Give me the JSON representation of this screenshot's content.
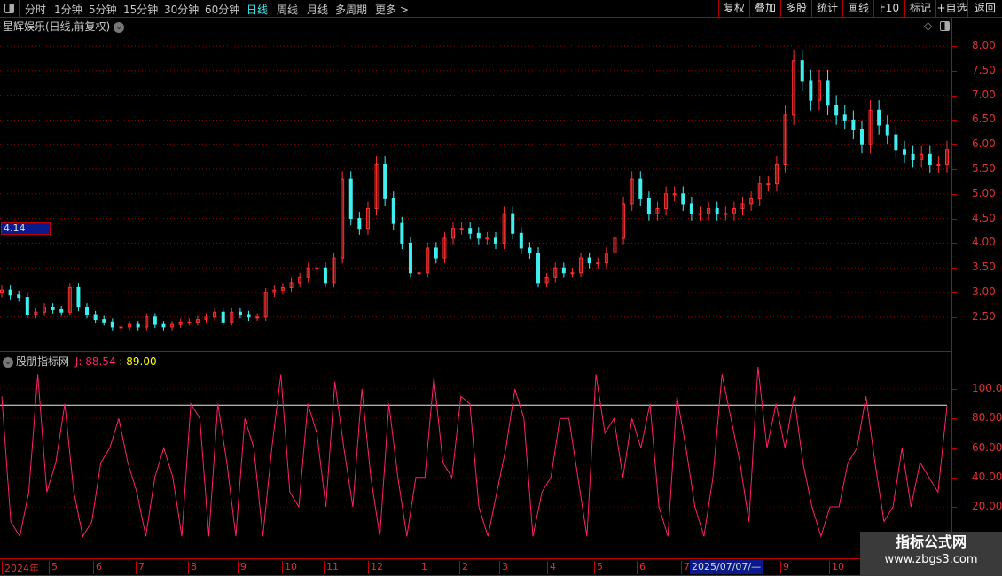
{
  "toolbar": {
    "periods": [
      "分时",
      "1分钟",
      "5分钟",
      "15分钟",
      "30分钟",
      "60分钟",
      "日线",
      "周线",
      "月线",
      "多周期",
      "更多 >"
    ],
    "active": "日线",
    "right_buttons": [
      "复权",
      "叠加",
      "多股",
      "统计",
      "画线",
      "F10",
      "标记",
      "+自选",
      "返回"
    ]
  },
  "stock_title": "星辉娱乐(日线,前复权)",
  "indicator": {
    "name": "股朋指标网",
    "j_label": "J: 88.54",
    "level_label": ": 89.00",
    "j_color": "#ff2070",
    "level_color": "#ffff00"
  },
  "current_price": "4.14",
  "price_axis": [
    "8.00",
    "7.50",
    "7.00",
    "6.50",
    "6.00",
    "5.50",
    "5.00",
    "4.50",
    "4.00",
    "3.50",
    "3.00",
    "2.50"
  ],
  "indicator_axis": [
    "100.0",
    "80.00",
    "60.00",
    "40.00",
    "20.00"
  ],
  "date_axis": [
    "2024年",
    "5",
    "6",
    "7",
    "8",
    "9",
    "10",
    "11",
    "12",
    "1",
    "2",
    "3",
    "4",
    "5",
    "6",
    "7",
    "9",
    "10"
  ],
  "date_highlight": "2025/07/07/—",
  "watermark": {
    "name": "指标公式网",
    "url": "www.zbgs3.com"
  },
  "colors": {
    "up": "#ff3030",
    "down": "#40f0f0",
    "grid": "#c00000"
  },
  "chart_data": [
    {
      "type": "candlestick",
      "ylim": [
        2.0,
        8.3
      ],
      "closes": [
        3.05,
        2.95,
        2.9,
        2.55,
        2.6,
        2.7,
        2.65,
        2.6,
        3.1,
        2.7,
        2.55,
        2.45,
        2.4,
        2.3,
        2.3,
        2.35,
        2.3,
        2.5,
        2.35,
        2.3,
        2.35,
        2.4,
        2.4,
        2.45,
        2.5,
        2.6,
        2.4,
        2.6,
        2.55,
        2.5,
        2.5,
        3.0,
        3.05,
        3.1,
        3.2,
        3.3,
        3.5,
        3.5,
        3.2,
        3.7,
        5.3,
        4.5,
        4.3,
        4.7,
        5.6,
        4.9,
        4.4,
        4.0,
        3.4,
        3.4,
        3.9,
        3.7,
        4.1,
        4.3,
        4.3,
        4.2,
        4.1,
        4.1,
        4.0,
        4.6,
        4.2,
        3.9,
        3.8,
        3.2,
        3.3,
        3.5,
        3.4,
        3.4,
        3.7,
        3.6,
        3.6,
        3.8,
        4.1,
        4.8,
        5.3,
        4.9,
        4.6,
        4.7,
        5.0,
        5.0,
        4.8,
        4.6,
        4.6,
        4.7,
        4.6,
        4.6,
        4.7,
        4.8,
        4.9,
        5.2,
        5.2,
        5.6,
        6.6,
        7.7,
        7.3,
        6.9,
        7.3,
        6.8,
        6.6,
        6.5,
        6.3,
        6.0,
        6.7,
        6.4,
        6.2,
        5.9,
        5.8,
        5.7,
        5.8,
        5.6,
        5.6,
        5.9
      ]
    },
    {
      "type": "line",
      "ylim": [
        -10,
        120
      ],
      "level": 89,
      "series": [
        {
          "name": "J",
          "values": [
            95,
            10,
            0,
            30,
            110,
            30,
            50,
            90,
            30,
            0,
            10,
            50,
            60,
            80,
            50,
            30,
            0,
            40,
            60,
            40,
            0,
            90,
            80,
            0,
            90,
            50,
            0,
            80,
            60,
            0,
            60,
            110,
            30,
            20,
            90,
            70,
            20,
            105,
            60,
            20,
            100,
            40,
            0,
            90,
            40,
            0,
            40,
            40,
            108,
            50,
            40,
            95,
            90,
            20,
            0,
            30,
            60,
            100,
            80,
            0,
            30,
            40,
            80,
            80,
            40,
            0,
            110,
            70,
            80,
            40,
            80,
            60,
            90,
            20,
            0,
            95,
            60,
            20,
            0,
            40,
            110,
            80,
            50,
            10,
            115,
            60,
            90,
            60,
            95,
            50,
            20,
            0,
            20,
            20,
            50,
            60,
            95,
            50,
            10,
            20,
            60,
            20,
            50,
            40,
            30,
            88.54
          ]
        }
      ]
    }
  ]
}
